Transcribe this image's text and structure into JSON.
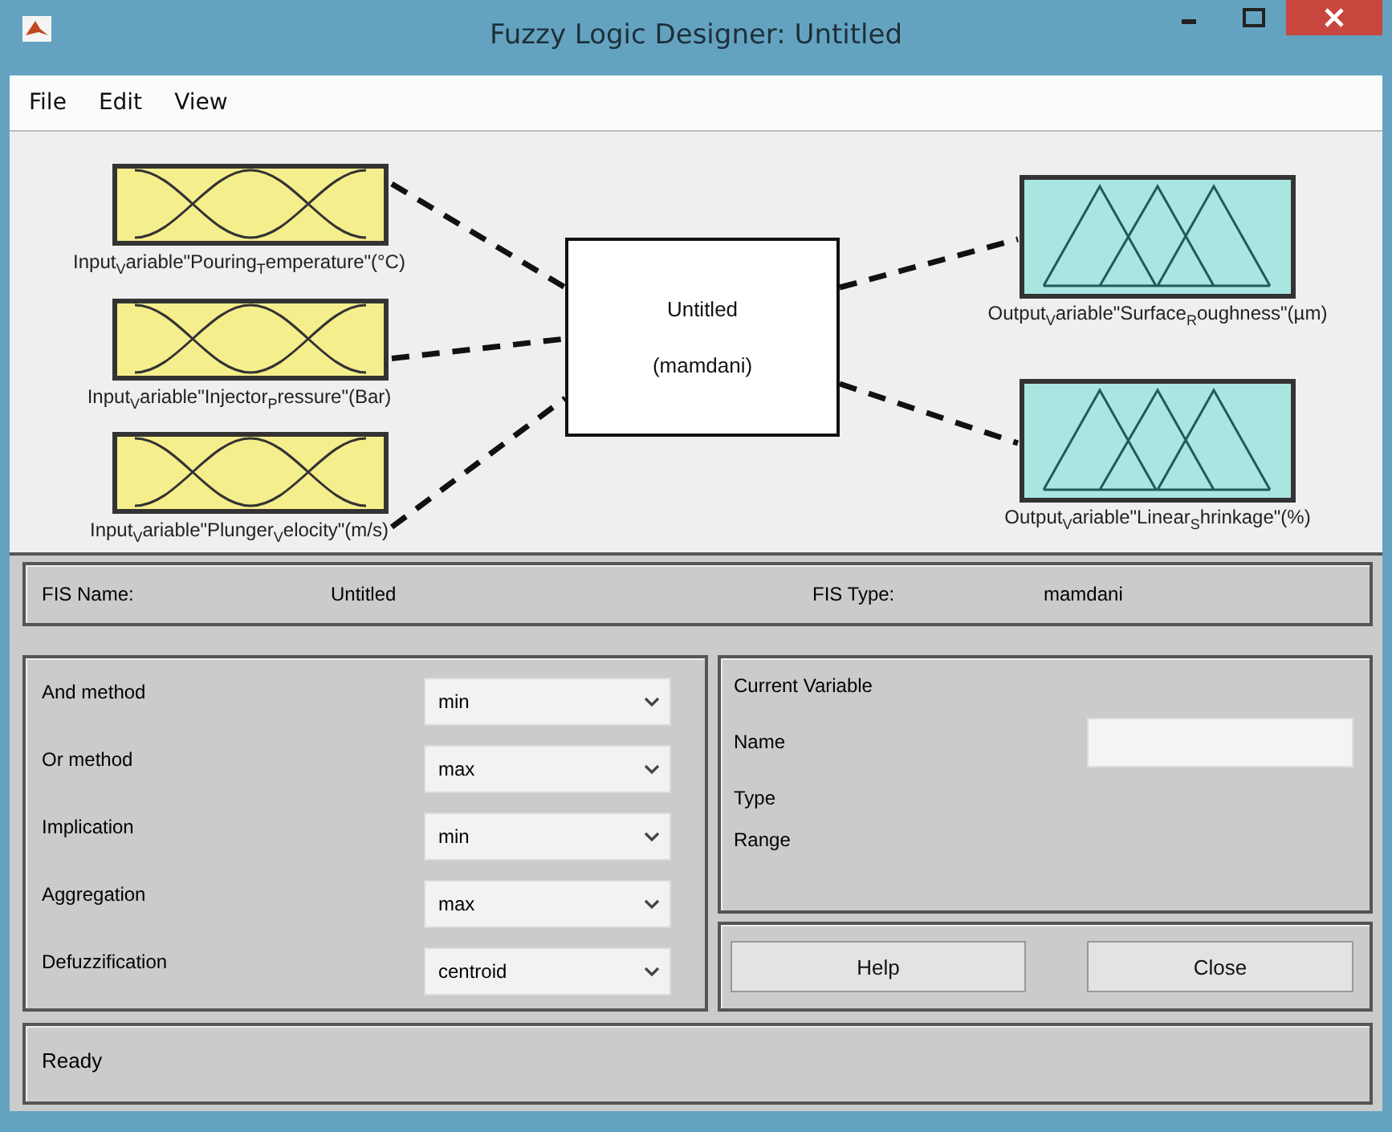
{
  "window": {
    "title": "Fuzzy Logic Designer: Untitled"
  },
  "menu": [
    "File",
    "Edit",
    "View"
  ],
  "diagram": {
    "inputs": [
      {
        "label": "Input$_{V}$ariable\"Pouring$_{T}$emperature\"(°C)"
      },
      {
        "label": "Input$_{V}$ariable\"Injector$_{P}$ressure\"(Bar)"
      },
      {
        "label": "Input$_{V}$ariable\"Plunger$_{V}$elocity\"(m/s)"
      }
    ],
    "system": {
      "name": "Untitled",
      "type": "(mamdani)"
    },
    "outputs": [
      {
        "label": "Output$_{V}$ariable\"Surface$_{R}$oughness\"(µm)"
      },
      {
        "label": "Output$_{V}$ariable\"Linear$_{S}$hrinkage\"(%)"
      }
    ]
  },
  "fis": {
    "name_label": "FIS Name:",
    "name": "Untitled",
    "type_label": "FIS Type:",
    "type": "mamdani"
  },
  "methods": [
    {
      "label": "And method",
      "value": "min"
    },
    {
      "label": "Or method",
      "value": "max"
    },
    {
      "label": "Implication",
      "value": "min"
    },
    {
      "label": "Aggregation",
      "value": "max"
    },
    {
      "label": "Defuzzification",
      "value": "centroid"
    }
  ],
  "current_variable": {
    "title": "Current Variable",
    "fields": [
      {
        "label": "Name",
        "kind": "input"
      },
      {
        "label": "Type",
        "kind": "text"
      },
      {
        "label": "Range",
        "kind": "text"
      }
    ]
  },
  "buttons": [
    "Help",
    "Close"
  ],
  "status": "Ready"
}
